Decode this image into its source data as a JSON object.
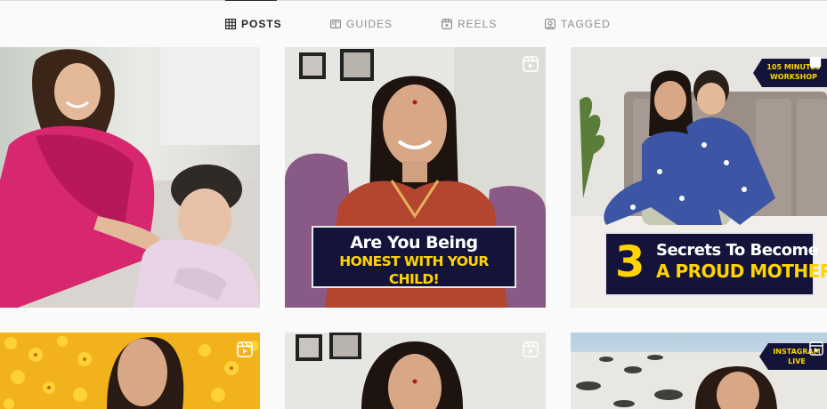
{
  "tabs": [
    {
      "label": "POSTS",
      "icon": "grid-icon",
      "active": true
    },
    {
      "label": "GUIDES",
      "icon": "guides-icon",
      "active": false
    },
    {
      "label": "REELS",
      "icon": "reels-icon",
      "active": false
    },
    {
      "label": "TAGGED",
      "icon": "tagged-icon",
      "active": false
    }
  ],
  "posts": [
    {
      "type": "photo",
      "caption": ""
    },
    {
      "type": "reel",
      "caption_line1": "Are You Being",
      "caption_line2": "HONEST WITH YOUR CHILD!"
    },
    {
      "type": "reel",
      "caption_number": "3",
      "caption_line1": "Secrets To Become",
      "caption_line2": "A PROUD MOTHER",
      "badge_line1": "105 MINUTES",
      "badge_line2": "WORKSHOP"
    },
    {
      "type": "reel"
    },
    {
      "type": "reel"
    },
    {
      "type": "reel",
      "badge_line1": "INSTAGRAM",
      "badge_line2": "LIVE"
    }
  ],
  "colors": {
    "background": "#fafafa",
    "active_tab": "#262626",
    "inactive_tab": "#8e8e8e",
    "banner_bg": "#14143a",
    "banner_accent": "#ffd400"
  }
}
